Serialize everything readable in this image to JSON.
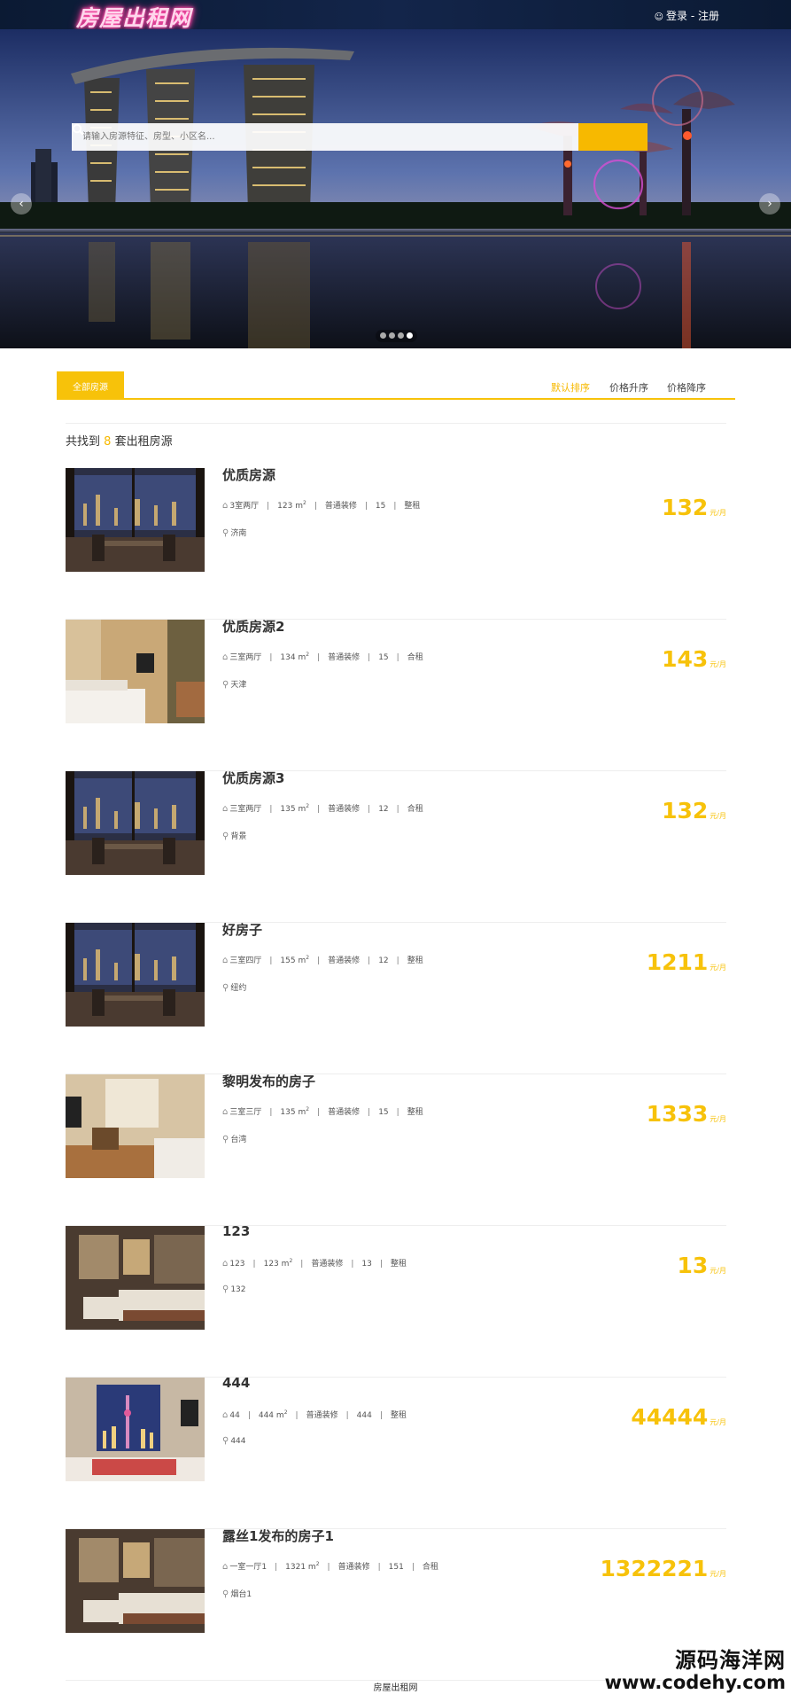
{
  "header": {
    "logo_text": "房屋出租网",
    "user_icon": "user-icon",
    "login_label": "登录",
    "separator": " - ",
    "register_label": "注册"
  },
  "banner": {
    "search_placeholder": "请输入房源特征、房型、小区名...",
    "search_icon": "search-icon",
    "prev_icon": "chevron-left-icon",
    "next_icon": "chevron-right-icon",
    "slide_count": 4,
    "active_slide": 4
  },
  "tabs": {
    "all_label": "全部房源",
    "sort_default": "默认排序",
    "sort_price_asc": "价格升序",
    "sort_price_desc": "价格降序"
  },
  "results": {
    "prefix": "共找到",
    "count": "8",
    "suffix": "套出租房源"
  },
  "listings": [
    {
      "title": "优质房源",
      "layout": "3室两厅",
      "area": "123",
      "decoration": "普通装修",
      "floor": "15",
      "rent_type": "整租",
      "location": "济南",
      "price": "132",
      "unit": "元/月"
    },
    {
      "title": "优质房源2",
      "layout": "三室两厅",
      "area": "134",
      "decoration": "普通装修",
      "floor": "15",
      "rent_type": "合租",
      "location": "天津",
      "price": "143",
      "unit": "元/月"
    },
    {
      "title": "优质房源3",
      "layout": "三室两厅",
      "area": "135",
      "decoration": "普通装修",
      "floor": "12",
      "rent_type": "合租",
      "location": "背景",
      "price": "132",
      "unit": "元/月"
    },
    {
      "title": "好房子",
      "layout": "三室四厅",
      "area": "155",
      "decoration": "普通装修",
      "floor": "12",
      "rent_type": "整租",
      "location": "纽约",
      "price": "1211",
      "unit": "元/月"
    },
    {
      "title": "黎明发布的房子",
      "layout": "三室三厅",
      "area": "135",
      "decoration": "普通装修",
      "floor": "15",
      "rent_type": "整租",
      "location": "台湾",
      "price": "1333",
      "unit": "元/月"
    },
    {
      "title": "123",
      "layout": "123",
      "area": "123",
      "decoration": "普通装修",
      "floor": "13",
      "rent_type": "整租",
      "location": "132",
      "price": "13",
      "unit": "元/月"
    },
    {
      "title": "444",
      "layout": "44",
      "area": "444",
      "decoration": "普通装修",
      "floor": "444",
      "rent_type": "整租",
      "location": "444",
      "price": "44444",
      "unit": "元/月"
    },
    {
      "title": "露丝1发布的房子1",
      "layout": "一室一厅1",
      "area": "1321",
      "decoration": "普通装修",
      "floor": "151",
      "rent_type": "合租",
      "location": "烟台1",
      "price": "1322221",
      "unit": "元/月"
    }
  ],
  "area_unit": "m",
  "area_sup": "2",
  "footer": {
    "text": "房屋出租网"
  },
  "watermark": {
    "line1": "源码海洋网",
    "line2": "www.codehy.com"
  },
  "colors": {
    "accent": "#f7c20a",
    "header_bg": "#0b1a33"
  }
}
